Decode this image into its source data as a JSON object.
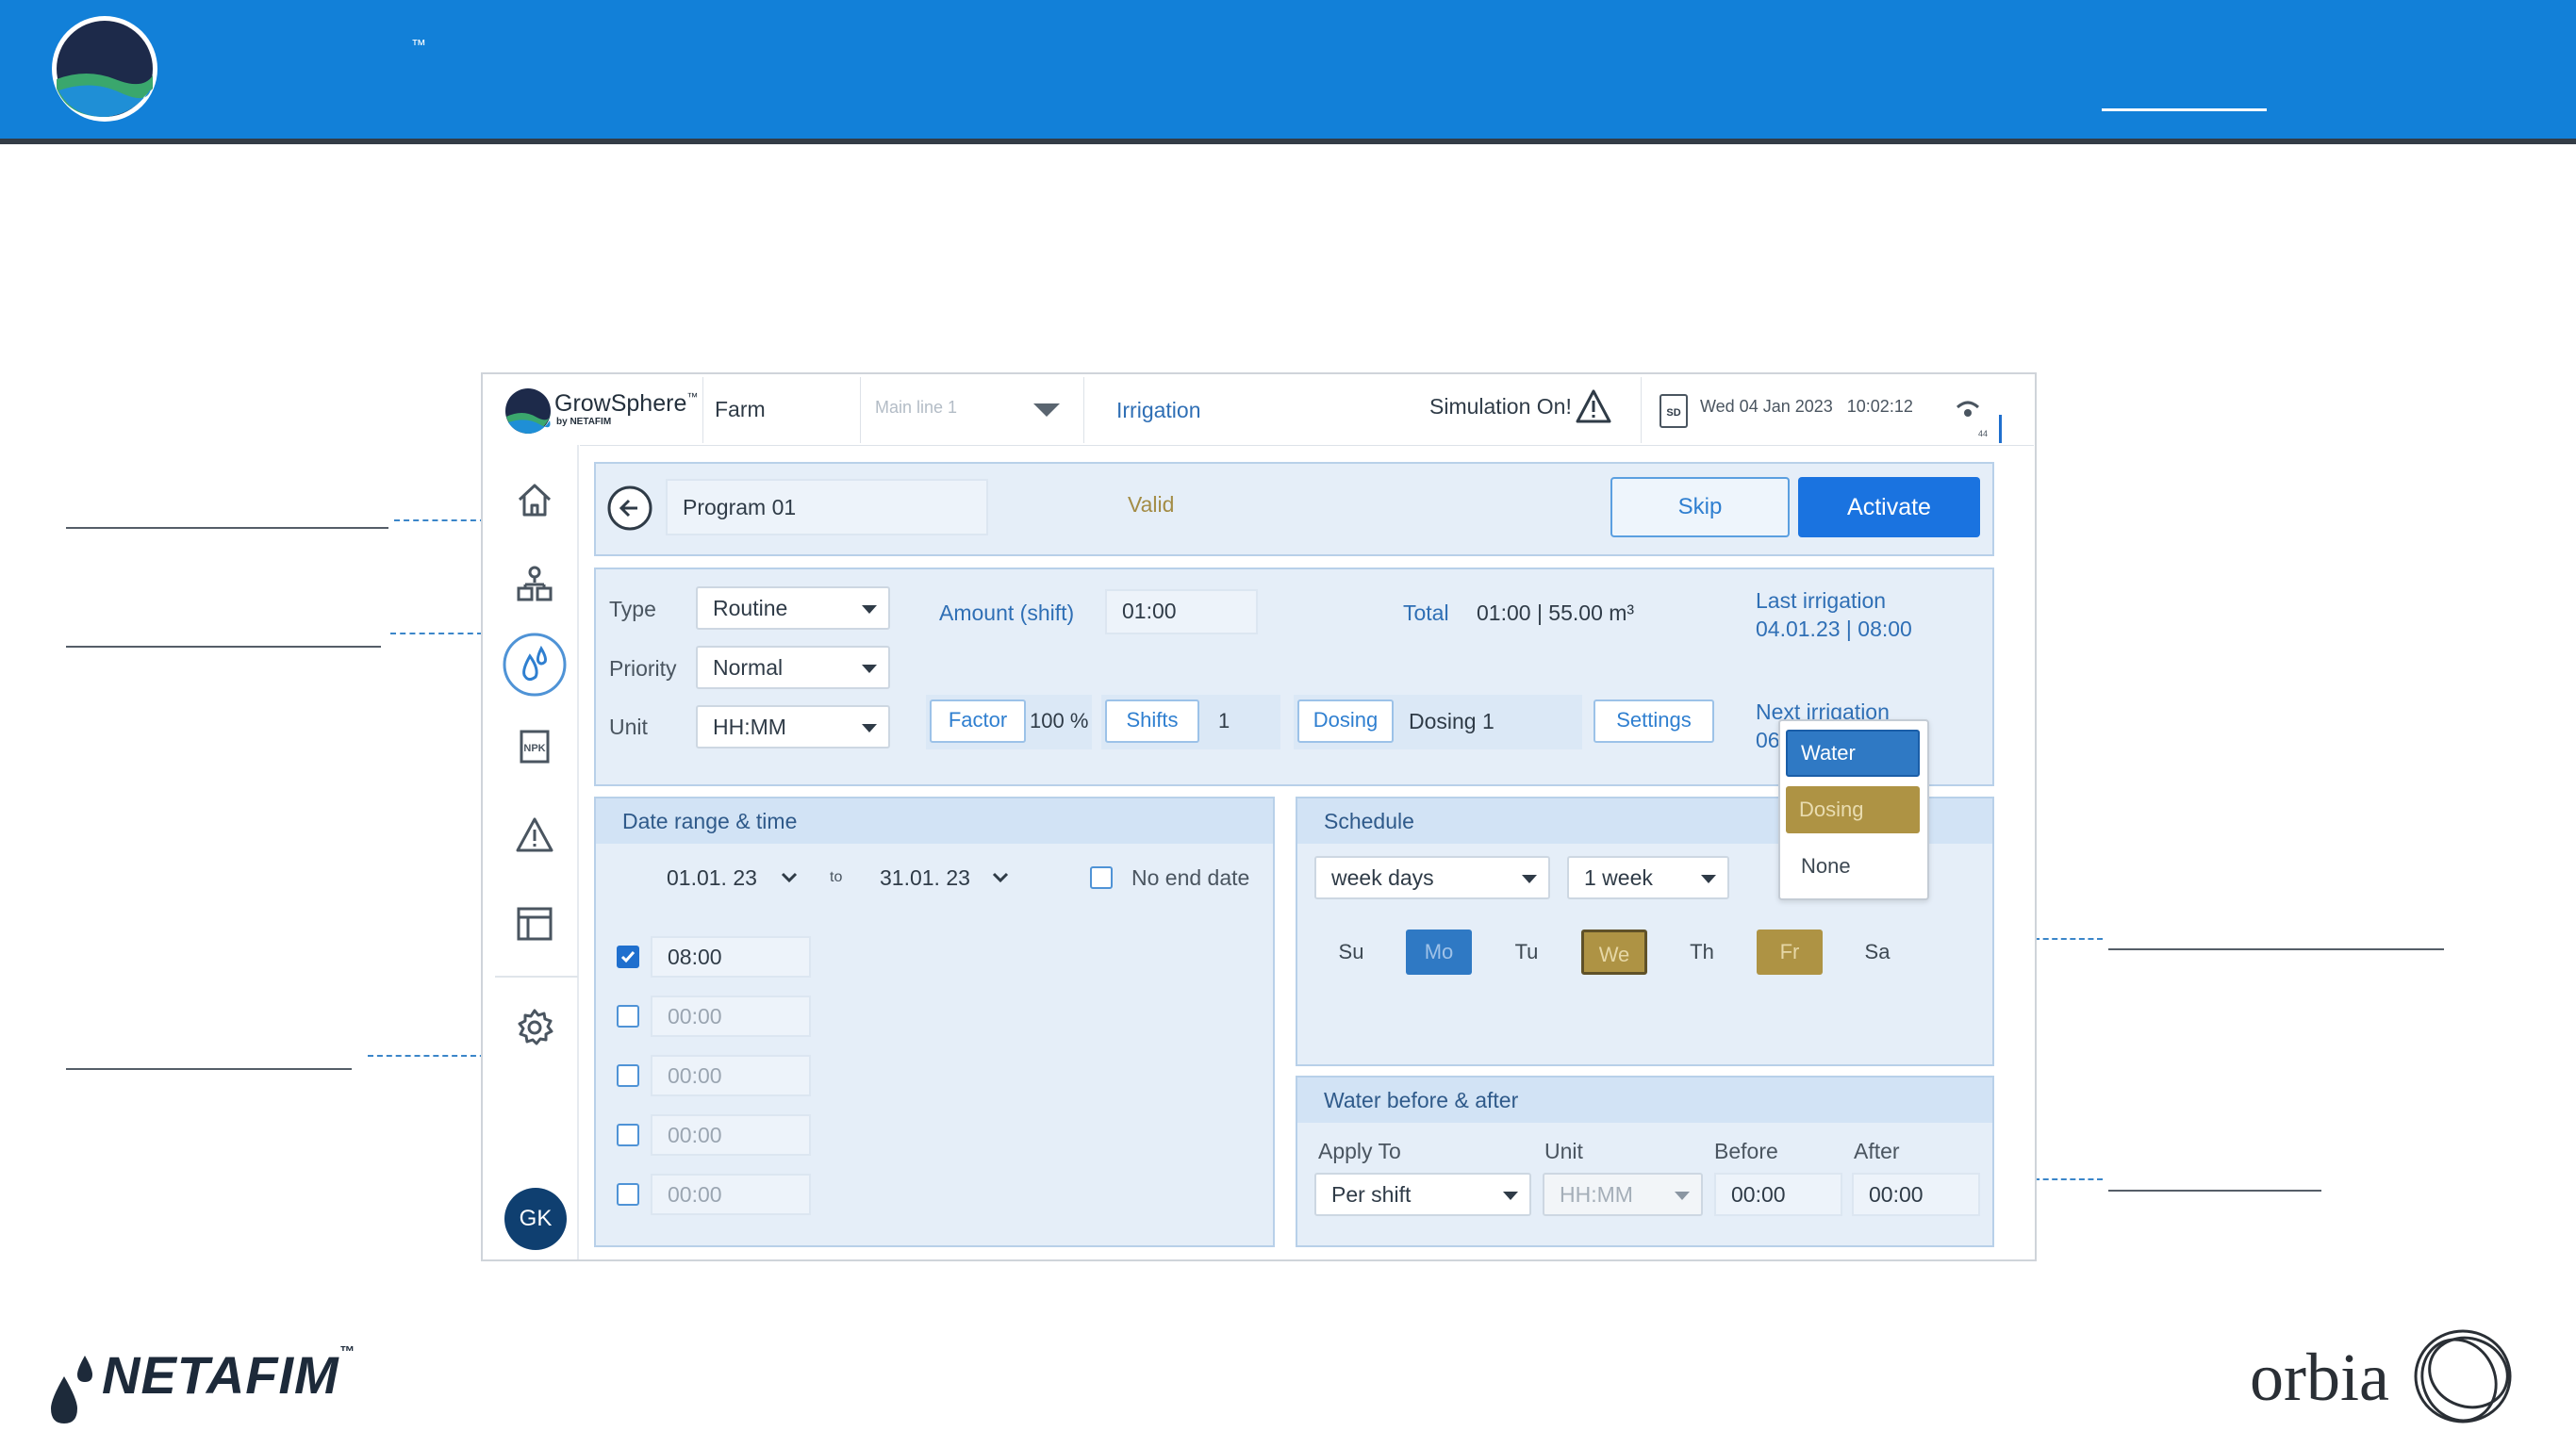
{
  "banner": {
    "trademark": "™"
  },
  "app": {
    "brand": "GrowSphere",
    "brand_tm": "™",
    "brand_sub": "by NETAFIM",
    "farm": "Farm",
    "line_select": "Main line 1",
    "section": "Irrigation",
    "simulation": "Simulation On!",
    "sd_label": "SD",
    "datetime": "Wed 04 Jan 2023   10:02:12",
    "signal_small": "44",
    "user_initials": "GK"
  },
  "program": {
    "name": "Program 01",
    "status": "Valid",
    "skip_label": "Skip",
    "activate_label": "Activate"
  },
  "details": {
    "type_label": "Type",
    "type_value": "Routine",
    "priority_label": "Priority",
    "priority_value": "Normal",
    "unit_label": "Unit",
    "unit_value": "HH:MM",
    "amount_label": "Amount (shift)",
    "amount_value": "01:00",
    "total_label": "Total",
    "total_value": "01:00 | 55.00 m³",
    "last_label": "Last irrigation",
    "last_value": "04.01.23 | 08:00",
    "next_label": "Next irrigation",
    "next_value_partial": "06",
    "factor_label": "Factor",
    "factor_value": "100 %",
    "shifts_label": "Shifts",
    "shifts_value": "1",
    "dosing_label": "Dosing",
    "dosing_value": "Dosing 1",
    "settings_label": "Settings"
  },
  "dropdown": {
    "options": [
      "Water",
      "Dosing",
      "None"
    ]
  },
  "date_range": {
    "title": "Date range & time",
    "from": "01.01. 23",
    "to_label": "to",
    "to": "31.01. 23",
    "no_end_label": "No end date",
    "times": [
      {
        "value": "08:00",
        "checked": true
      },
      {
        "value": "00:00",
        "checked": false
      },
      {
        "value": "00:00",
        "checked": false
      },
      {
        "value": "00:00",
        "checked": false
      },
      {
        "value": "00:00",
        "checked": false
      }
    ]
  },
  "schedule": {
    "title": "Schedule",
    "mode": "week days",
    "period": "1 week",
    "days": [
      "Su",
      "Mo",
      "Tu",
      "We",
      "Th",
      "Fr",
      "Sa"
    ]
  },
  "water": {
    "title": "Water before & after",
    "apply_label": "Apply To",
    "apply_value": "Per shift",
    "unit_label": "Unit",
    "unit_value": "HH:MM",
    "before_label": "Before",
    "before_value": "00:00",
    "after_label": "After",
    "after_value": "00:00"
  },
  "footer": {
    "netafim": "NETAFIM",
    "netafim_tm": "™",
    "orbia": "orbia"
  },
  "colors": {
    "banner": "#1280d8",
    "activate": "#1a73e0",
    "gold": "#ae9344",
    "panel": "#e5eef8"
  }
}
